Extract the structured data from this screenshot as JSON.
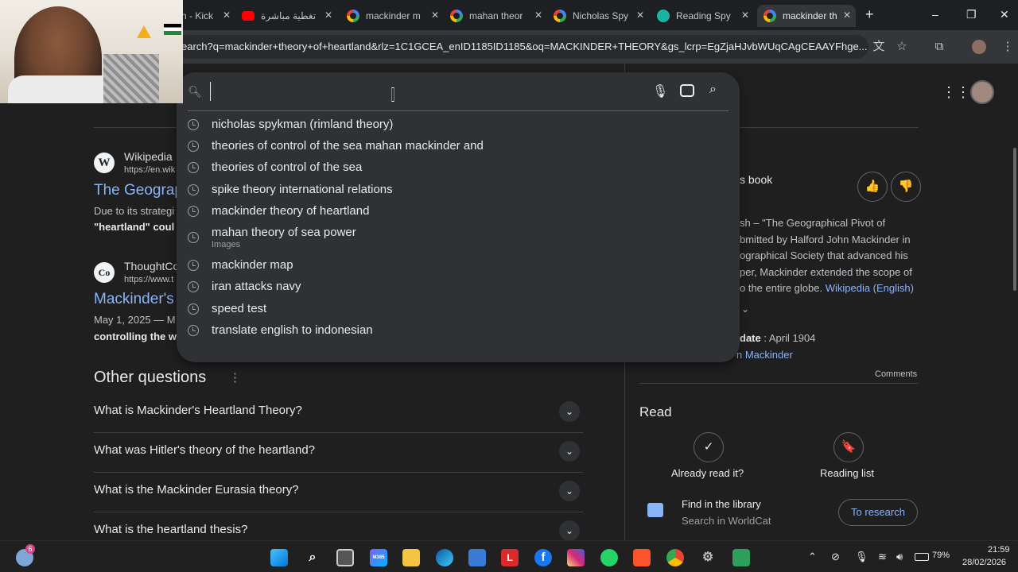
{
  "tabs": [
    {
      "title": "n - Kick"
    },
    {
      "title": "تغطية مباشرة"
    },
    {
      "title": "mackinder m"
    },
    {
      "title": "mahan theor"
    },
    {
      "title": "Nicholas Spy"
    },
    {
      "title": "Reading Spy"
    },
    {
      "title": "mackinder th"
    }
  ],
  "new_tab_symbol": "+",
  "window": {
    "minimize": "–",
    "restore": "❐",
    "close": "✕"
  },
  "address_bar": {
    "url": "earch?q=mackinder+theory+of+heartland&rlz=1C1GCEA_enID1185ID1185&oq=MACKINDER+THEORY&gs_lcrp=EgZjaHJvbWUqCAgCEAAYFhge..."
  },
  "search_dropdown": {
    "input_value": "",
    "suggestions": [
      {
        "text": "nicholas spykman (rimland theory)",
        "sub": ""
      },
      {
        "text": "theories of control of the sea mahan mackinder and",
        "sub": ""
      },
      {
        "text": "theories of control of the sea",
        "sub": ""
      },
      {
        "text": "spike theory international relations",
        "sub": ""
      },
      {
        "text": "mackinder theory of heartland",
        "sub": ""
      },
      {
        "text": "mahan theory of sea power",
        "sub": "Images"
      },
      {
        "text": "mackinder map",
        "sub": ""
      },
      {
        "text": "iran attacks navy",
        "sub": ""
      },
      {
        "text": "speed test",
        "sub": ""
      },
      {
        "text": "translate english to indonesian",
        "sub": ""
      }
    ]
  },
  "results": [
    {
      "source": "Wikipedia",
      "url": "https://en.wik",
      "title": "The Geograp",
      "snippet1": "Due to its strategi",
      "snippet2": "\"heartland\" coul",
      "icon_letter": "W"
    },
    {
      "source": "ThoughtCo",
      "url": "https://www.t",
      "title": "Mackinder's",
      "snippet1": "May 1, 2025 — M",
      "snippet2": "controlling the w",
      "icon_letter": "Co"
    }
  ],
  "other_questions": {
    "heading": "Other questions",
    "menu_symbol": "⋮",
    "items": [
      "What is Mackinder's Heartland Theory?",
      "What was Hitler's theory of the heartland?",
      "What is the Mackinder Eurasia theory?",
      "What is the heartland thesis?"
    ]
  },
  "knowledge_panel": {
    "heading_fragment": "s book",
    "description_lines": [
      "sh  –  \"The Geographical Pivot of",
      "bmitted by Halford John Mackinder in",
      "ographical Society that advanced his",
      "per, Mackinder extended the scope of",
      "o the entire globe."
    ],
    "wiki_link": "Wikipedia (English)",
    "date_label": "date",
    "date_value": ": April 1904",
    "author_link": "n Mackinder",
    "comments": "Comments",
    "read_heading": "Read",
    "already_read": "Already read it?",
    "reading_list": "Reading list",
    "find_library": "Find in the library",
    "worldcat": "Search in WorldCat",
    "to_research": "To research"
  },
  "taskbar": {
    "weather_badge": "6",
    "battery": "79%",
    "time": "21:59",
    "date": "28/02/2026",
    "lang": "M365",
    "app_letter_l": "L",
    "app_letter_f": "f"
  },
  "colors": {
    "accent": "#8ab4f8",
    "page_bg": "#1f1f1f",
    "dropdown_bg": "#303134"
  }
}
